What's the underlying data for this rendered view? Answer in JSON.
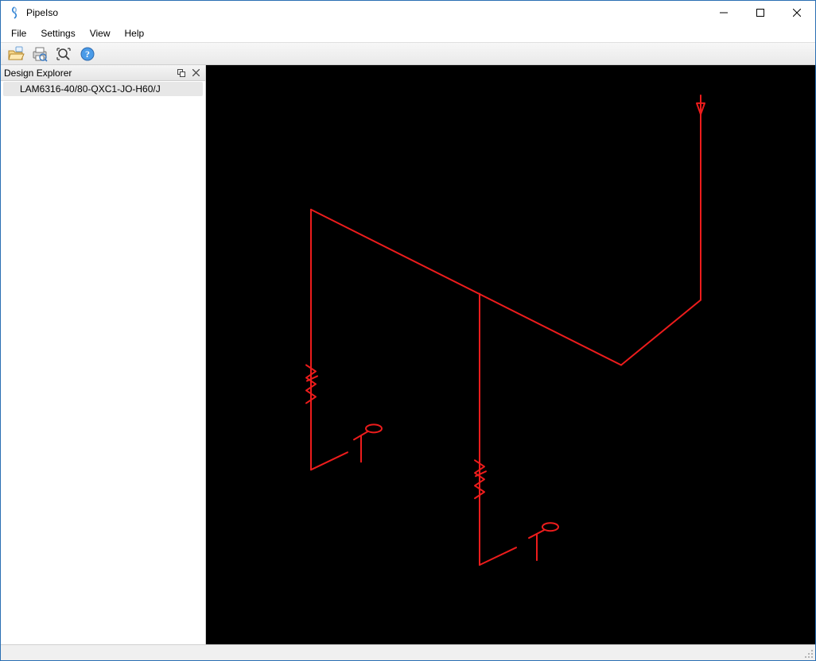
{
  "window": {
    "title": "PipeIso"
  },
  "menubar": {
    "items": [
      "File",
      "Settings",
      "View",
      "Help"
    ]
  },
  "toolbar": {
    "buttons": [
      {
        "name": "folder-icon"
      },
      {
        "name": "print-preview-icon"
      },
      {
        "name": "zoom-extents-icon"
      },
      {
        "name": "help-icon"
      }
    ]
  },
  "panel": {
    "title": "Design Explorer",
    "items": [
      {
        "label": "LAM6316-40/80-QXC1-JO-H60/J"
      }
    ]
  },
  "drawing": {
    "line_color": "#ed1c1c",
    "stroke_width": 2
  }
}
